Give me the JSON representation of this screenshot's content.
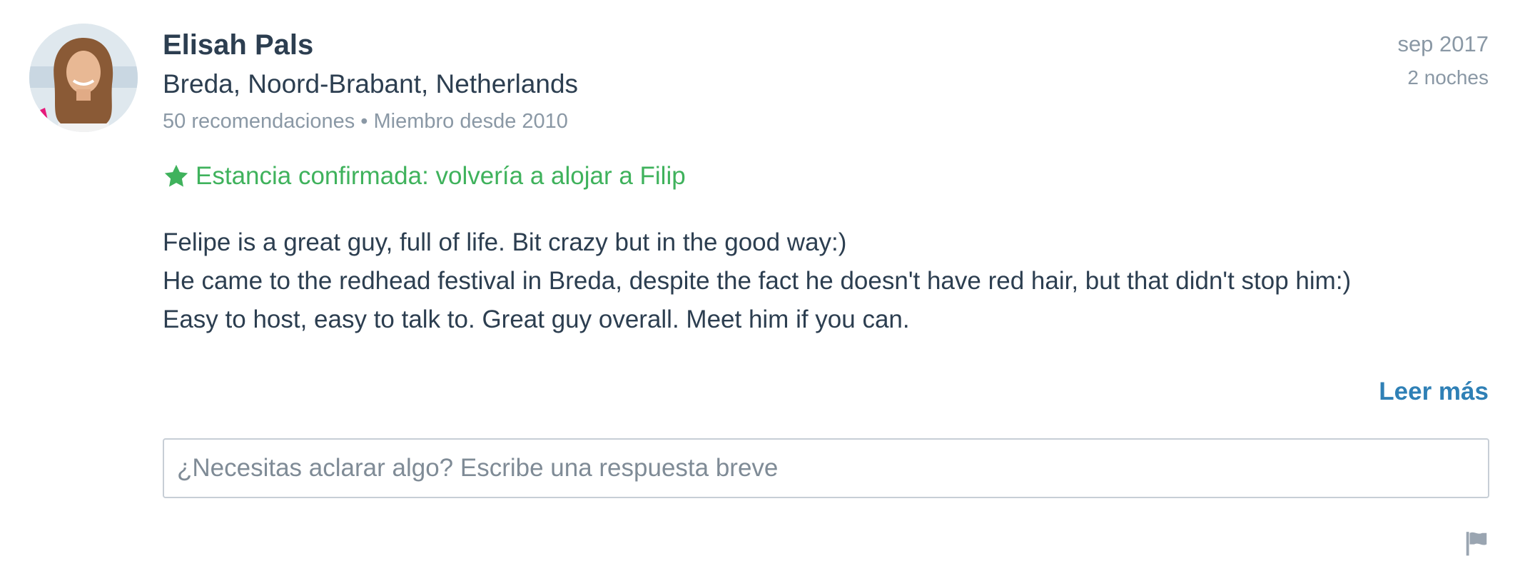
{
  "reviewer": {
    "name": "Elisah Pals",
    "location": "Breda, Noord-Brabant, Netherlands",
    "meta": "50 recomendaciones • Miembro desde 2010"
  },
  "stay": {
    "date": "sep 2017",
    "nights": "2 noches"
  },
  "confirmation": {
    "text": "Estancia confirmada: volvería a alojar a Filip",
    "icon": "star-icon",
    "color": "#3fb25c"
  },
  "review": {
    "lines": [
      "Felipe is a great guy, full of life. Bit crazy but in the good way:)",
      "He came to the redhead festival in Breda, despite the fact he doesn't have red hair, but that didn't stop him:)",
      "Easy to host, easy to talk to. Great guy overall. Meet him if you can."
    ]
  },
  "actions": {
    "read_more": "Leer más",
    "flag_icon": "flag-icon"
  },
  "reply": {
    "placeholder": "¿Necesitas aclarar algo? Escribe una respuesta breve",
    "value": ""
  },
  "colors": {
    "link": "#2f80b6",
    "muted": "#8a98a5",
    "text": "#2c3e50"
  }
}
